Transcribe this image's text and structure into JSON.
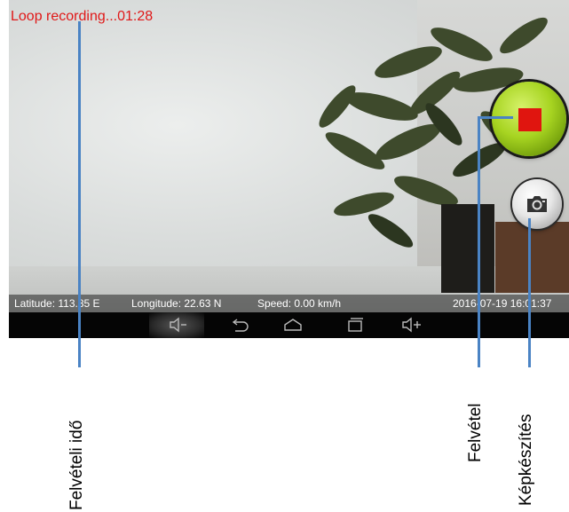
{
  "recording_status": "Loop recording...01:28",
  "info_bar": {
    "latitude": "Latitude: 113.85 E",
    "longitude": "Longitude: 22.63 N",
    "speed": "Speed: 0.00 km/h",
    "datetime": "2016-07-19 16:01:37"
  },
  "nav_bar": {
    "icons": [
      "volume-down-icon",
      "back-icon",
      "home-icon",
      "recent-apps-icon",
      "volume-up-icon"
    ]
  },
  "buttons": {
    "record": "stop-record-icon",
    "photo": "camera-icon"
  },
  "annotations": {
    "recording_time": "Felvételi idő",
    "record": "Felvétel",
    "photo": "Képkészítés"
  },
  "colors": {
    "status_text": "#e01818",
    "callout": "#4a83c4",
    "record_button": "#a7d421",
    "stop_square": "#e0150f"
  }
}
